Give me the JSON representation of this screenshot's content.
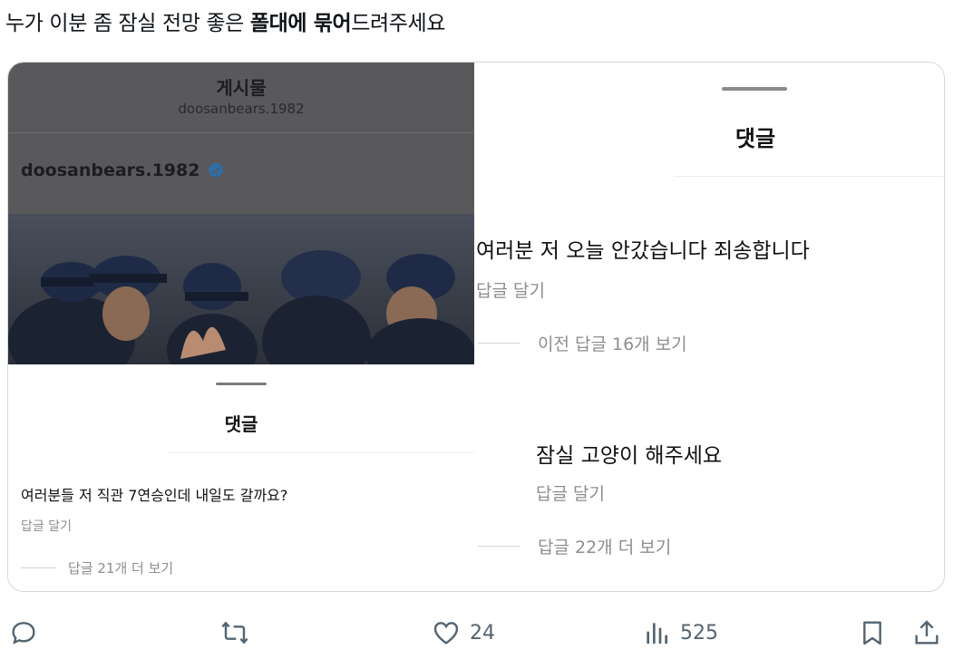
{
  "tweet": {
    "text_part1": "누가 이분 좀 잠실 전망 좋은 ",
    "text_bold": "폴대에 묶어",
    "text_part2": "드려주세요"
  },
  "left_screenshot": {
    "header_title": "게시물",
    "header_subtitle": "doosanbears.1982",
    "account_name": "doosanbears.1982",
    "sheet_title": "댓글",
    "comment": "여러분들 저 직관 7연승인데 내일도 갈까요?",
    "reply_label": "답글 달기",
    "more_replies": "답글 21개 더 보기"
  },
  "right_screenshot": {
    "sheet_title": "댓글",
    "comment1": "여러분 저 오늘 안갔습니다 죄송합니다",
    "reply1": "답글 달기",
    "more1": "이전 답글 16개 보기",
    "comment2": "잠실 고양이 해주세요",
    "reply2": "답글 달기",
    "more2": "답글 22개 더 보기"
  },
  "actions": {
    "reply_icon": "reply-icon",
    "retweet_icon": "retweet-icon",
    "like_icon": "heart-icon",
    "like_count": "24",
    "views_icon": "views-icon",
    "views_count": "525",
    "bookmark_icon": "bookmark-icon",
    "share_icon": "share-icon"
  },
  "colors": {
    "action_gray": "#536471",
    "verified_blue": "#3897f0",
    "card_border": "#cfd9de"
  }
}
